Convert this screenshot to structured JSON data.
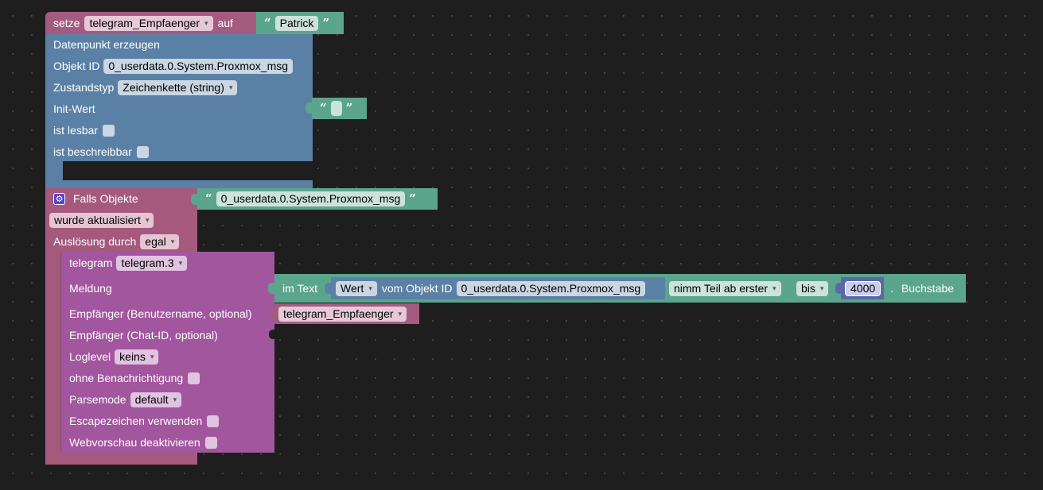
{
  "set_block": {
    "label_set": "setze",
    "variable": "telegram_Empfaenger",
    "label_to": "auf",
    "value": "Patrick"
  },
  "create_block": {
    "title": "Datenpunkt erzeugen",
    "object_id_label": "Objekt ID",
    "object_id": "0_userdata.0.System.Proxmox_msg",
    "state_type_label": "Zustandstyp",
    "state_type": "Zeichenkette (string)",
    "init_label": "Init-Wert",
    "init_value": "",
    "readable_label": "ist lesbar",
    "writable_label": "ist beschreibbar"
  },
  "trigger_block": {
    "title": "Falls Objekte",
    "object_id": "0_userdata.0.System.Proxmox_msg",
    "condition": "wurde aktualisiert",
    "trigger_label": "Auslösung durch",
    "trigger_value": "egal"
  },
  "telegram_block": {
    "label": "telegram",
    "instance": "telegram.3",
    "message_label": "Meldung",
    "recipient_user_label": "Empfänger (Benutzername, optional)",
    "recipient_user_value": "telegram_Empfaenger",
    "recipient_chat_label": "Empfänger (Chat-ID, optional)",
    "loglevel_label": "Loglevel",
    "loglevel": "keins",
    "silent_label": "ohne Benachrichtigung",
    "parsemode_label": "Parsemode",
    "parsemode": "default",
    "escape_label": "Escapezeichen verwenden",
    "preview_label": "Webvorschau deaktivieren"
  },
  "text_block": {
    "in_text_label": "im Text",
    "value_dd": "Wert",
    "from_object_label": "vom Objekt ID",
    "object_id": "0_userdata.0.System.Proxmox_msg",
    "substring_mode": "nimm Teil ab erster",
    "until_mode": "bis",
    "number": "4000",
    "dot": ".",
    "suffix": "Buchstabe"
  },
  "glyphs": {
    "open_quote": "“",
    "close_quote": "”",
    "dropdown_arrow": "▾",
    "gear": "⚙"
  },
  "colors": {
    "variable": "#a55b80",
    "object": "#5b80a5",
    "string": "#5ba58c",
    "event": "#a5597d",
    "telegram": "#a2569e",
    "number": "#5c68a6"
  }
}
